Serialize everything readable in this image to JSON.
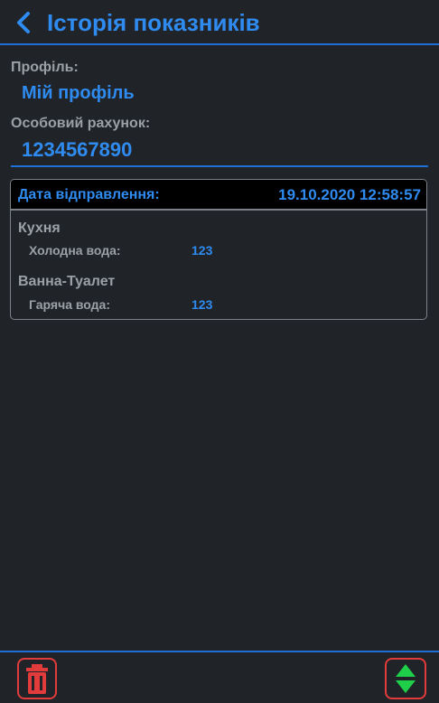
{
  "header": {
    "title": "Історія показників"
  },
  "profile": {
    "label": "Профіль:",
    "value": "Мій профіль"
  },
  "account": {
    "label": "Особовий рахунок:",
    "value": "1234567890"
  },
  "record": {
    "date_label": "Дата відправлення:",
    "date_value": "19.10.2020 12:58:57",
    "rooms": [
      {
        "name": "Кухня",
        "meter": "Холодна вода:",
        "reading": "123"
      },
      {
        "name": "Ванна-Туалет",
        "meter": "Гаряча вода:",
        "reading": "123"
      }
    ]
  },
  "footer": {
    "delete_icon": "trash-icon",
    "sort_icon": "sort-up-down-icon"
  },
  "colors": {
    "background": "#202428",
    "accent": "#2f8bf0",
    "label": "#9aa0a6",
    "danger": "#e23b3b",
    "sort": "#1fcf4a"
  }
}
